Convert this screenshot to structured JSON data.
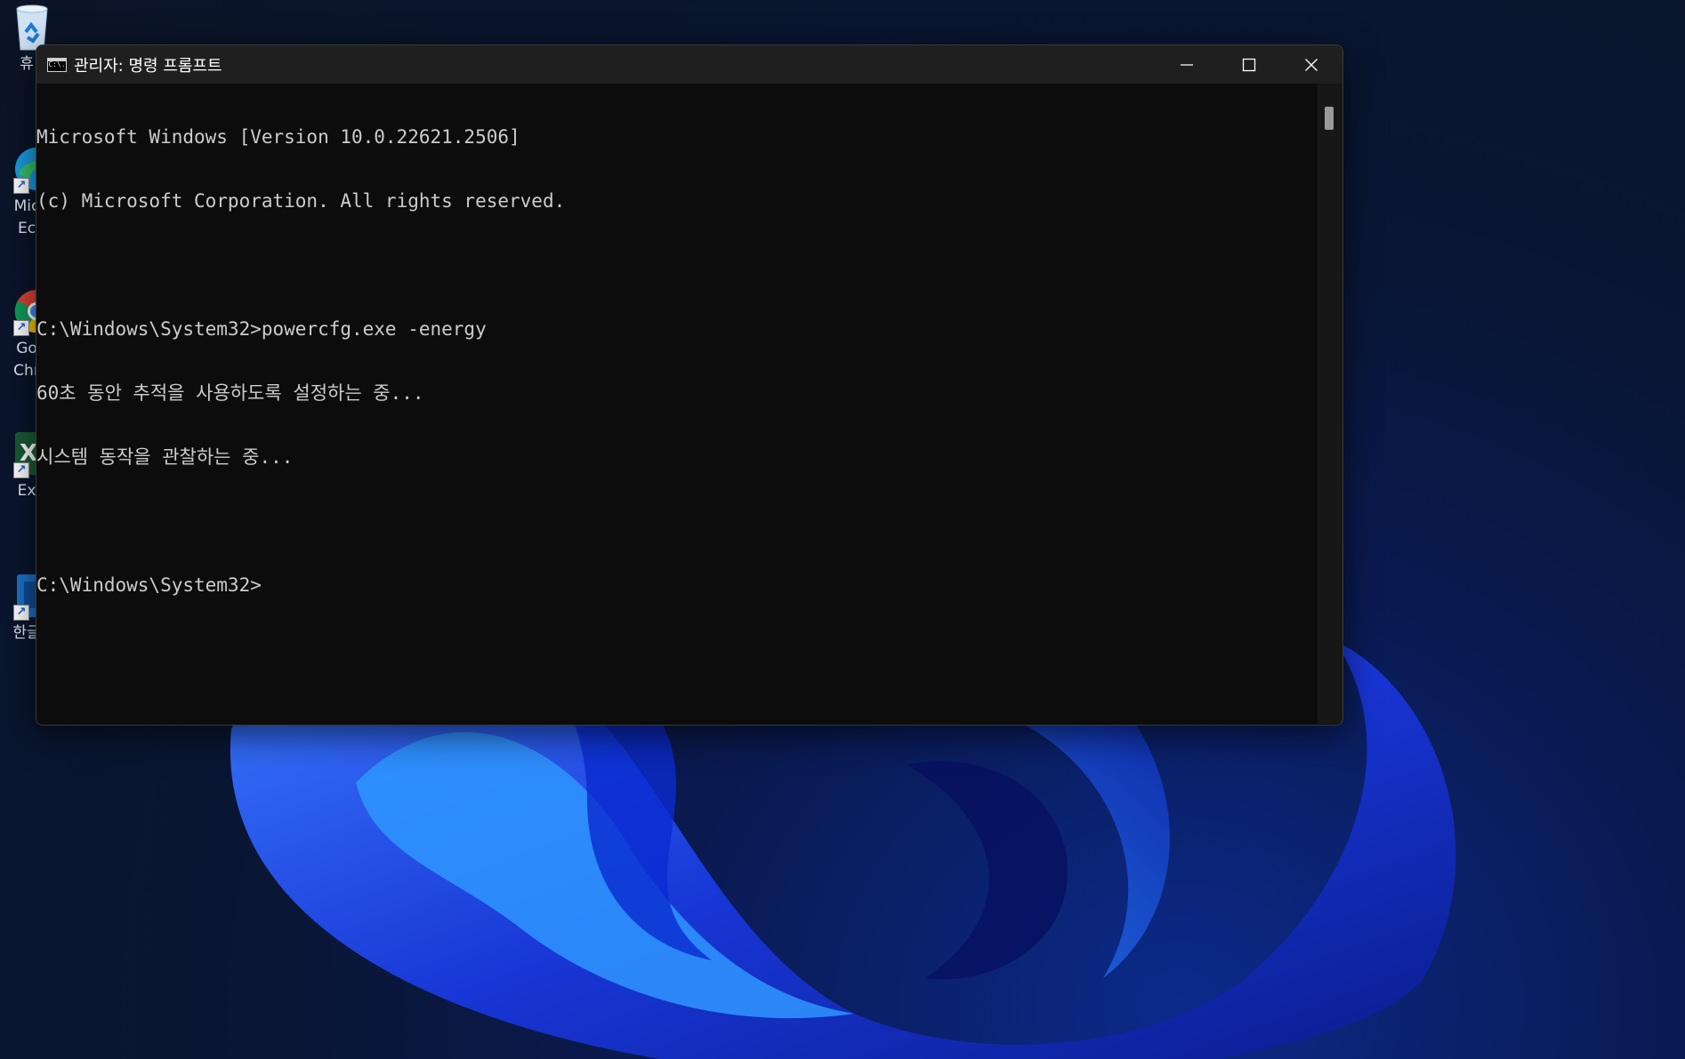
{
  "desktop": {
    "icons": [
      {
        "id": "recycle-bin",
        "label_lines": [
          "휴"
        ]
      },
      {
        "id": "edge",
        "label_lines": [
          "Mic",
          "Ec"
        ]
      },
      {
        "id": "chrome",
        "label_lines": [
          "Go",
          "Chr"
        ]
      },
      {
        "id": "excel",
        "label_lines": [
          "Ex"
        ]
      },
      {
        "id": "hangul",
        "label_lines": [
          "한글"
        ]
      }
    ]
  },
  "window": {
    "title": "관리자: 명령 프롬프트",
    "icon_text": "C:\\.",
    "controls": {
      "minimize": "minimize-icon",
      "maximize": "maximize-icon",
      "close": "close-icon"
    }
  },
  "console": {
    "lines": [
      "Microsoft Windows [Version 10.0.22621.2506]",
      "(c) Microsoft Corporation. All rights reserved.",
      "",
      "C:\\Windows\\System32>powercfg.exe -energy",
      "60초 동안 추적을 사용하도록 설정하는 중...",
      "시스템 동작을 관찰하는 중...",
      "",
      "C:\\Windows\\System32>"
    ]
  },
  "colors": {
    "console_bg": "#0c0c0c",
    "console_fg": "#cccccc",
    "titlebar_bg": "#1f1f1f"
  }
}
